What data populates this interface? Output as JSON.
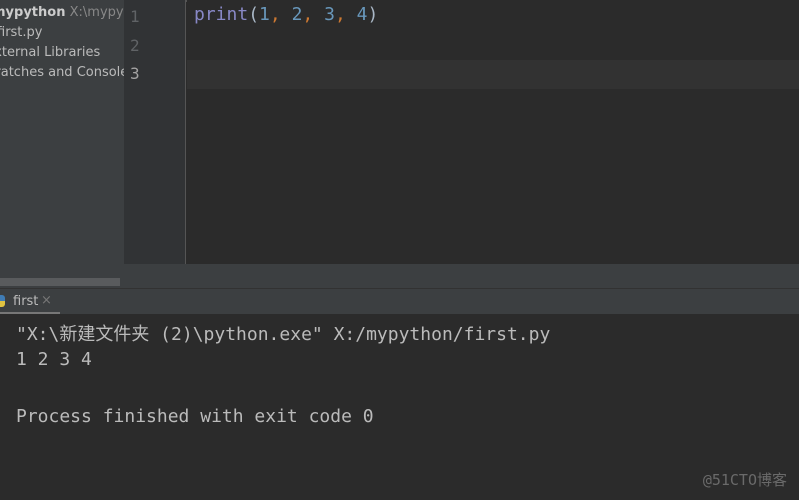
{
  "project": {
    "name": "mypython",
    "path": "X:\\mypython",
    "items": [
      "first.py",
      "External Libraries",
      "Scratches and Consoles"
    ]
  },
  "editor": {
    "line_numbers": [
      "1",
      "2",
      "3"
    ],
    "code": {
      "func": "print",
      "open": "(",
      "args": [
        "1",
        "2",
        "3",
        "4"
      ],
      "sep": ", ",
      "close": ")"
    }
  },
  "run": {
    "tab_label": "first",
    "close": "×",
    "lines": [
      "\"X:\\新建文件夹 (2)\\python.exe\" X:/mypython/first.py",
      "1 2 3 4",
      "",
      "Process finished with exit code 0"
    ]
  },
  "watermark": "@51CTO博客",
  "colors": {
    "func": "#8888c6",
    "number": "#6897bb",
    "comma": "#cc7832",
    "text": "#a9b7c6"
  }
}
